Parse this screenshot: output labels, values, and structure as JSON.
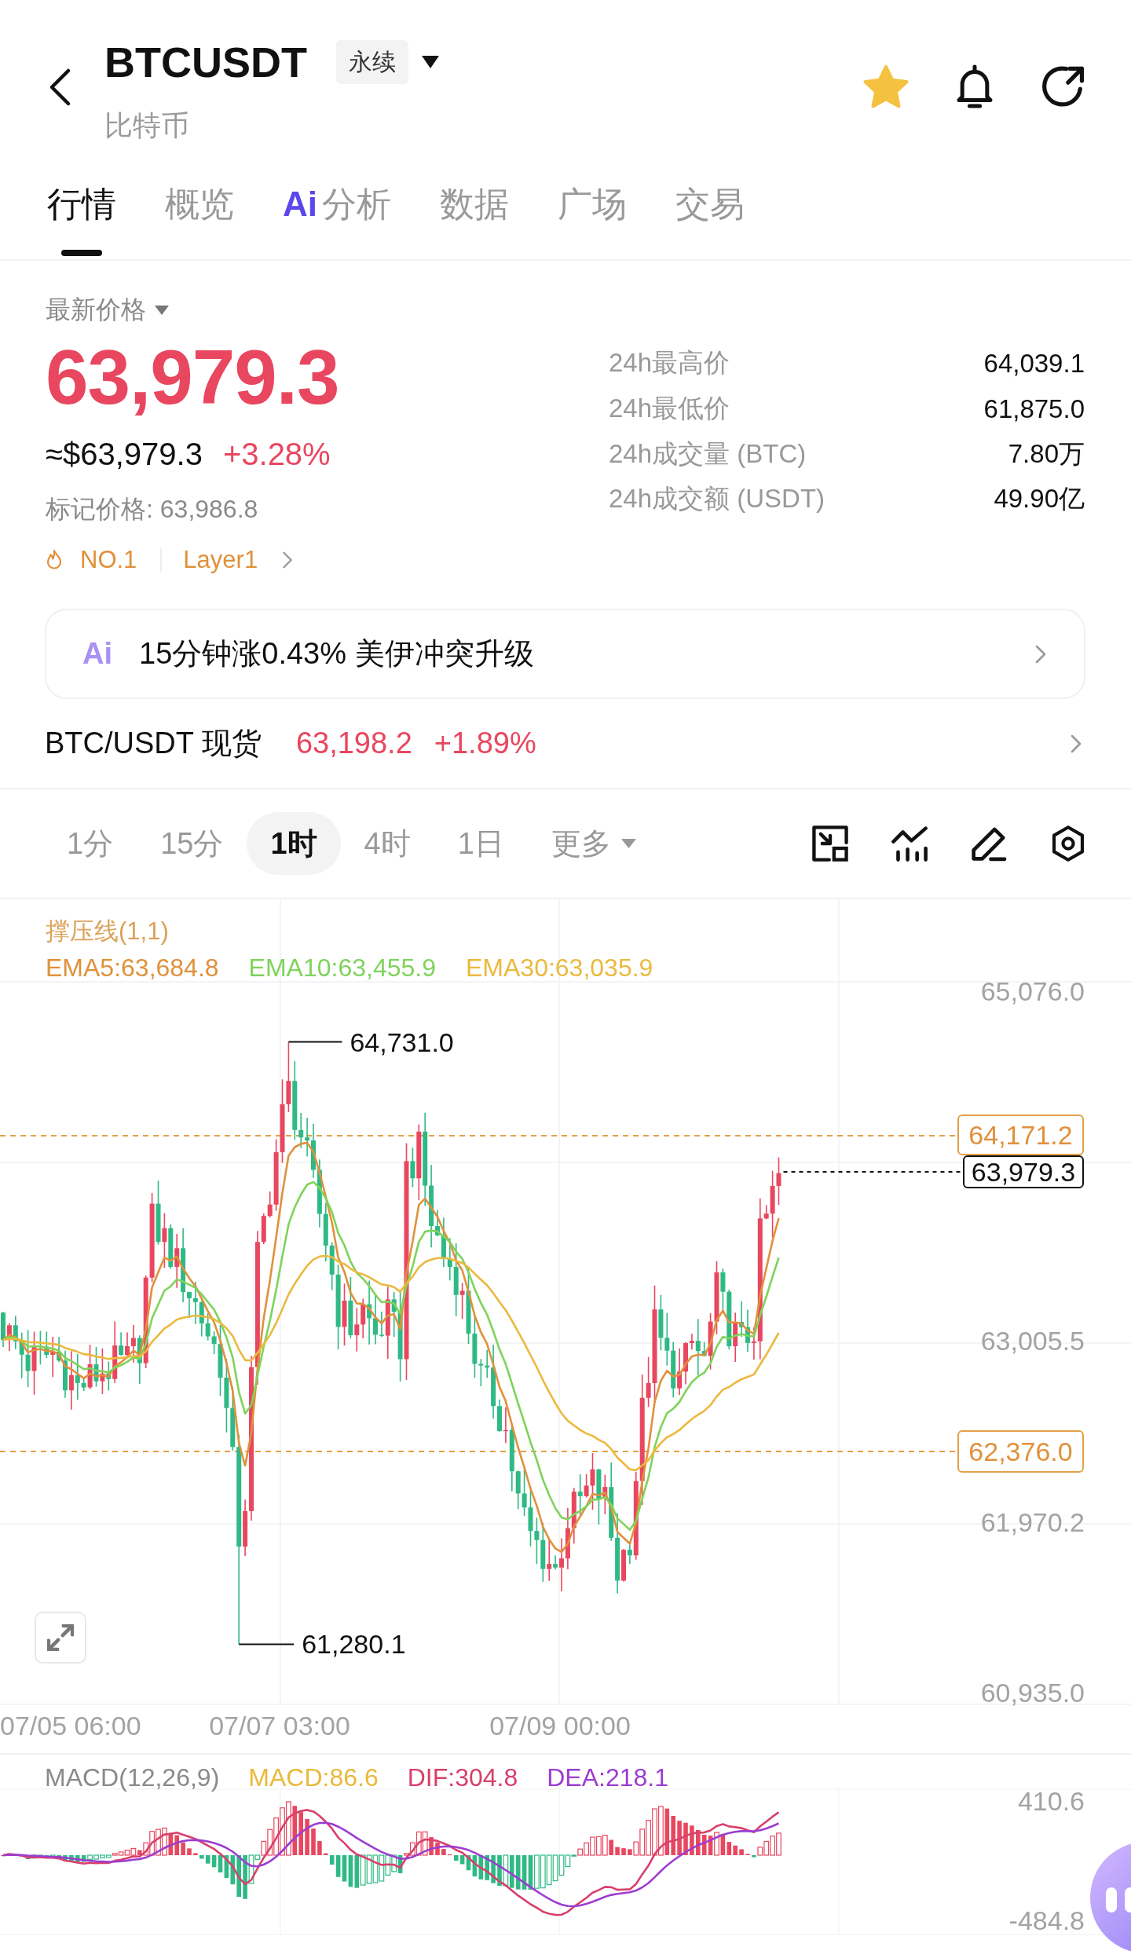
{
  "header": {
    "symbol": "BTCUSDT",
    "contract_type": "永续",
    "name": "比特币",
    "favorited": true
  },
  "tabs": [
    {
      "label": "行情",
      "selected": true
    },
    {
      "label": "概览",
      "selected": false
    },
    {
      "badge": "Ai",
      "label": "分析",
      "selected": false
    },
    {
      "label": "数据",
      "selected": false
    },
    {
      "label": "广场",
      "selected": false
    },
    {
      "label": "交易",
      "selected": false
    }
  ],
  "price": {
    "label": "最新价格",
    "last": "63,979.3",
    "usd": "≈$63,979.3",
    "change": "+3.28%",
    "mark": "标记价格: 63,986.8",
    "rank": "NO.1",
    "sector": "Layer1"
  },
  "stats": [
    {
      "label": "24h最高价",
      "value": "64,039.1"
    },
    {
      "label": "24h最低价",
      "value": "61,875.0"
    },
    {
      "label": "24h成交量 (BTC)",
      "value": "7.80万"
    },
    {
      "label": "24h成交额 (USDT)",
      "value": "49.90亿"
    }
  ],
  "ai_banner": {
    "badge": "Ai",
    "text": "15分钟涨0.43% 美伊冲突升级"
  },
  "spot": {
    "pair": "BTC/USDT 现货",
    "price": "63,198.2",
    "change": "+1.89%"
  },
  "intervals": [
    {
      "label": "1分",
      "kind": "period",
      "selected": false
    },
    {
      "label": "15分",
      "kind": "period",
      "selected": false
    },
    {
      "label": "1时",
      "kind": "period",
      "selected": true
    },
    {
      "label": "4时",
      "kind": "period",
      "selected": false
    },
    {
      "label": "1日",
      "kind": "period",
      "selected": false
    },
    {
      "label": "更多",
      "kind": "menu",
      "selected": false
    }
  ],
  "chart": {
    "indicator": "撑压线(1,1)",
    "ema": [
      {
        "text": "EMA5:63,684.8",
        "color": "#e0913c"
      },
      {
        "text": "EMA10:63,455.9",
        "color": "#7fd35b"
      },
      {
        "text": "EMA30:63,035.9",
        "color": "#ebb93f"
      }
    ],
    "y_axis": [
      "65,076.0",
      "63,005.5",
      "61,970.2",
      "60,935.0"
    ],
    "x_axis": [
      "07/05 06:00",
      "07/07 03:00",
      "07/09 00:00"
    ],
    "high": "64,731.0",
    "low": "61,280.1",
    "resistance": "64,171.2",
    "support": "62,376.0",
    "last_price": "63,979.3"
  },
  "macd": {
    "title": "MACD(12,26,9)",
    "values": [
      {
        "text": "MACD:86.6",
        "color": "#e9b93b"
      },
      {
        "text": "DIF:304.8",
        "color": "#d8406c"
      },
      {
        "text": "DEA:218.1",
        "color": "#9c3dd1"
      }
    ],
    "y_axis": [
      "410.6",
      "-484.8"
    ]
  }
}
